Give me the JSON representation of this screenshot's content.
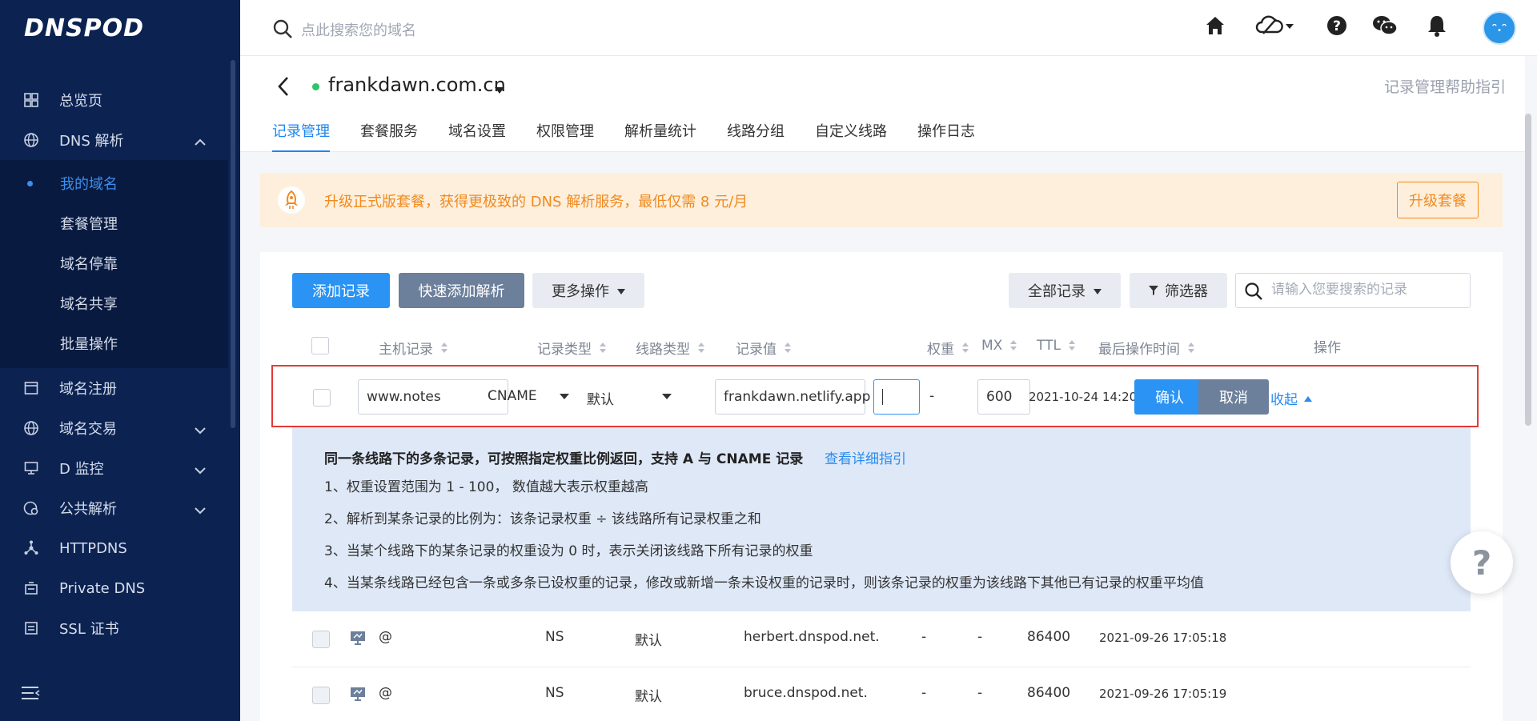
{
  "sidebar": {
    "logo": "DNSPOD",
    "items": [
      {
        "label": "总览页",
        "icon": "dashboard-icon"
      },
      {
        "label": "DNS 解析",
        "icon": "globe-icon",
        "expanded": true
      }
    ],
    "dns_sub": [
      {
        "label": "我的域名",
        "active": true
      },
      {
        "label": "套餐管理"
      },
      {
        "label": "域名停靠"
      },
      {
        "label": "域名共享"
      },
      {
        "label": "批量操作"
      }
    ],
    "items_after": [
      {
        "label": "域名注册",
        "icon": "calendar-icon"
      },
      {
        "label": "域名交易",
        "icon": "globe-icon"
      },
      {
        "label": "D 监控",
        "icon": "monitor-icon"
      },
      {
        "label": "公共解析",
        "icon": "public-dns-icon"
      },
      {
        "label": "HTTPDNS",
        "icon": "nodes-icon"
      },
      {
        "label": "Private DNS",
        "icon": "private-dns-icon"
      },
      {
        "label": "SSL 证书",
        "icon": "certificate-icon"
      }
    ]
  },
  "topbar": {
    "search_placeholder": "点此搜索您的域名"
  },
  "domain": {
    "name": "frankdawn.com.cn",
    "status_color": "#2ec36d",
    "help_link": "记录管理帮助指引",
    "tabs": [
      "记录管理",
      "套餐服务",
      "域名设置",
      "权限管理",
      "解析量统计",
      "线路分组",
      "自定义线路",
      "操作日志"
    ],
    "active_tab": 0
  },
  "banner": {
    "text": "升级正式版套餐，获得更极致的 DNS 解析服务，最低仅需 8 元/月",
    "button": "升级套餐"
  },
  "toolbar": {
    "add_record": "添加记录",
    "quick_add": "快速添加解析",
    "more_ops": "更多操作",
    "all_records": "全部记录",
    "filter": "筛选器",
    "search_placeholder": "请输入您要搜索的记录"
  },
  "table": {
    "headers": {
      "host": "主机记录",
      "type": "记录类型",
      "line": "线路类型",
      "value": "记录值",
      "weight": "权重",
      "mx": "MX",
      "ttl": "TTL",
      "updated": "最后操作时间",
      "actions": "操作"
    },
    "edit_row": {
      "host": "www.notes",
      "type": "CNAME",
      "line": "默认",
      "value": "frankdawn.netlify.app",
      "weight": "",
      "mx": "-",
      "ttl": "600",
      "updated": "2021-10-24 14:20",
      "confirm": "确认",
      "cancel": "取消",
      "collapse": "收起"
    },
    "tips": {
      "title": "同一条线路下的多条记录，可按照指定权重比例返回，支持 A 与 CNAME 记录",
      "link": "查看详细指引",
      "lines": [
        "1、权重设置范围为 1 - 100， 数值越大表示权重越高",
        "2、解析到某条记录的比例为：该条记录权重 ÷ 该线路所有记录权重之和",
        "3、当某个线路下的某条记录的权重设为 0 时，表示关闭该线路下所有记录的权重",
        "4、当某条线路已经包含一条或多条已设权重的记录，修改或新增一条未设权重的记录时，则该条记录的权重为该线路下其他已有记录的权重平均值"
      ]
    },
    "rows": [
      {
        "host": "@",
        "type": "NS",
        "line": "默认",
        "value": "herbert.dnspod.net.",
        "weight": "-",
        "mx": "-",
        "ttl": "86400",
        "updated": "2021-09-26 17:05:18"
      },
      {
        "host": "@",
        "type": "NS",
        "line": "默认",
        "value": "bruce.dnspod.net.",
        "weight": "-",
        "mx": "-",
        "ttl": "86400",
        "updated": "2021-09-26 17:05:19"
      }
    ]
  },
  "help_fab": "?"
}
